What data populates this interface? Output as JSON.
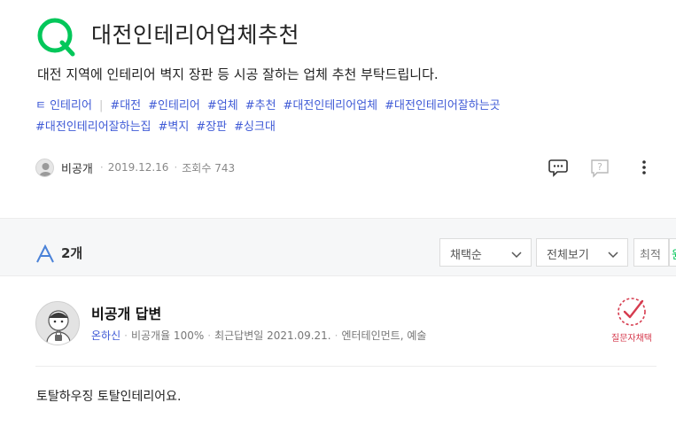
{
  "question": {
    "title": "대전인테리어업체추천",
    "body": "대전 지역에 인테리어 벽지 장판 등 시공 잘하는 업체 추천 부탁드립니다.",
    "category_partial": "ㅌ 인테리어",
    "tags_row1": [
      "#대전",
      "#인테리어",
      "#업체",
      "#추천",
      "#대전인테리어업체",
      "#대전인테리어잘하는곳"
    ],
    "tags_row2": [
      "#대전인테리어잘하는집",
      "#벽지",
      "#장판",
      "#싱크대"
    ],
    "author": "비공개",
    "date": "2019.12.16",
    "views": "조회수 743"
  },
  "answers_bar": {
    "count": "2개",
    "sort_label": "채택순",
    "view_label": "전체보기",
    "latest_label": "최적",
    "green_partial": "원"
  },
  "answer": {
    "title": "비공개 답변",
    "grade": "온하신",
    "private_ratio": "비공개율 100%",
    "recent": "최근답변일 2021.09.21.",
    "field": "엔터테인먼트, 예술",
    "adopt_label": "질문자채택",
    "body": "토탈하우징 토탈인테리어요."
  },
  "colors": {
    "brand_green": "#03c75a",
    "tag_blue": "#3f5ad6",
    "adopt_red": "#d63c4f",
    "answer_icon_blue": "#4a82d8"
  },
  "icons": {
    "question": "q-icon",
    "comment": "comment-icon",
    "report": "report-icon",
    "more": "more-icon",
    "answer": "answer-a-icon",
    "adopt": "adopt-check-icon"
  }
}
